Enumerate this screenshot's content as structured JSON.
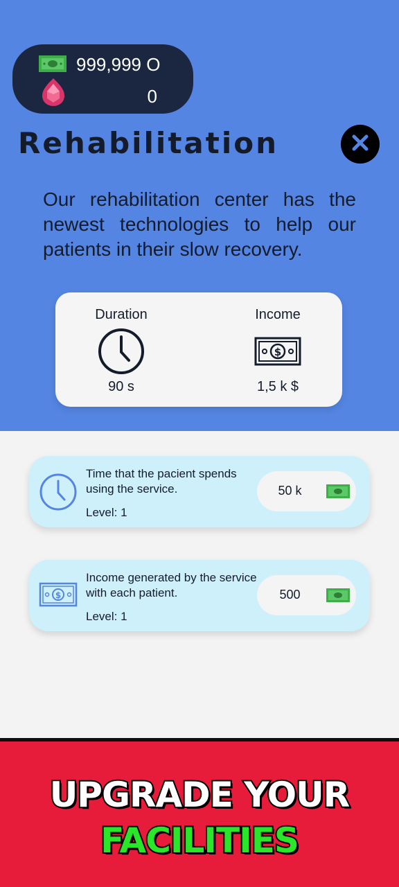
{
  "wallet": {
    "money": "999,999 O",
    "gems": "0"
  },
  "facility": {
    "title": "Rehabilitation",
    "description": "Our rehabilitation center has the newest technologies to help our patients in their slow recovery."
  },
  "stats": {
    "duration_label": "Duration",
    "duration_value": "90 s",
    "income_label": "Income",
    "income_value": "1,5 k $"
  },
  "upgrades": [
    {
      "description": "Time that the pacient spends using the service.",
      "level": "Level: 1",
      "price": "50 k",
      "icon": "clock-icon"
    },
    {
      "description": "Income generated by the service with each patient.",
      "level": "Level: 1",
      "price": "500",
      "icon": "banknote-icon"
    }
  ],
  "banner": {
    "line1": "UPGRADE YOUR",
    "line2": "FACILITIES"
  },
  "colors": {
    "header_bg": "#5485e2",
    "wallet_bg": "#1b2640",
    "card_bg": "#cdf0fb",
    "banner_bg": "#e71c3a",
    "banner_highlight": "#2ae52a",
    "cash_green": "#3fae49"
  }
}
